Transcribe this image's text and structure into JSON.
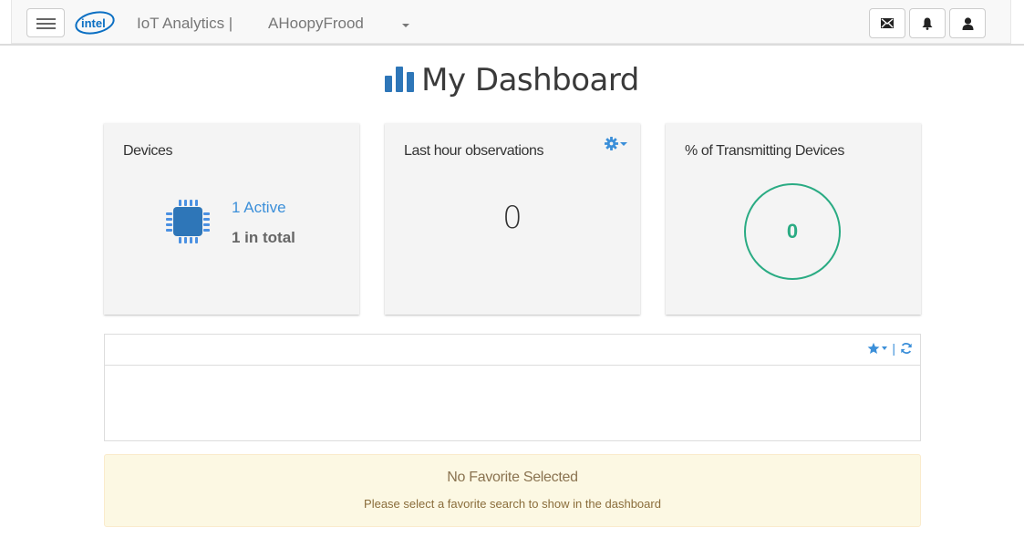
{
  "navbar": {
    "brand_logo": "intel",
    "app_title": "IoT Analytics |",
    "account_name": "AHoopyFrood",
    "icons": [
      "menu-icon",
      "mail-icon",
      "bell-icon",
      "user-icon"
    ]
  },
  "page": {
    "title": "My Dashboard",
    "title_icon": "bar-chart-icon"
  },
  "cards": {
    "devices": {
      "title": "Devices",
      "active_label": "1 Active",
      "total_label": "1 in total",
      "icon": "chip-icon"
    },
    "observations": {
      "title": "Last hour observations",
      "value": "0",
      "icon": "gear-icon"
    },
    "transmitting": {
      "title": "% of Transmitting Devices",
      "value": "0"
    }
  },
  "favorites_panel": {
    "icons": [
      "star-icon",
      "refresh-icon"
    ],
    "separator": "|"
  },
  "alert": {
    "heading": "No Favorite Selected",
    "message": "Please select a favorite search to show in the dashboard"
  },
  "colors": {
    "accent": "#3b8fd9",
    "success": "#2aab83",
    "warning_bg": "#fcf8e3",
    "warning_text": "#8a6d3b"
  }
}
